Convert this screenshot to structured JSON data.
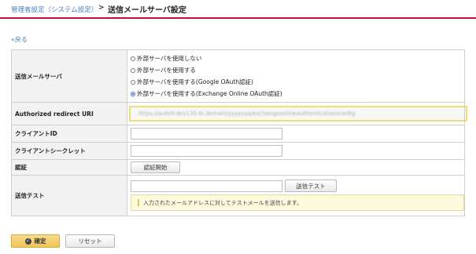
{
  "breadcrumb": {
    "parent": "管理者設定（システム設定）",
    "separator": ">",
    "title": "送信メールサーバ設定"
  },
  "back_link": "«戻る",
  "form": {
    "mail_server": {
      "label": "送信メールサーバ",
      "options": [
        "外部サーバを使用しない",
        "外部サーバを使用する",
        "外部サーバを使用する(Google OAuth認証)",
        "外部サーバを使用する(Exchange Online OAuth認証)"
      ],
      "selected_index": 3
    },
    "redirect_uri": {
      "label": "Authorized redirect URI",
      "value": "https://autoX-dev135.tk.domain/yyyyyya/exchangeonlineauthentication/config"
    },
    "client_id": {
      "label": "クライアントID",
      "value": ""
    },
    "client_secret": {
      "label": "クライアントシークレット",
      "value": ""
    },
    "auth": {
      "label": "認証",
      "button": "認証開始"
    },
    "send_test": {
      "label": "送信テスト",
      "value": "",
      "button": "送信テスト",
      "notice": "入力されたメールアドレスに対してテストメールを送信します。"
    }
  },
  "footer": {
    "confirm_label": "確定",
    "reset_label": "リセット"
  },
  "colors": {
    "accent_line": "#c8102e",
    "link": "#4a7fc1",
    "confirm_button": "#f2cc66",
    "highlight_border": "#f0de74"
  }
}
